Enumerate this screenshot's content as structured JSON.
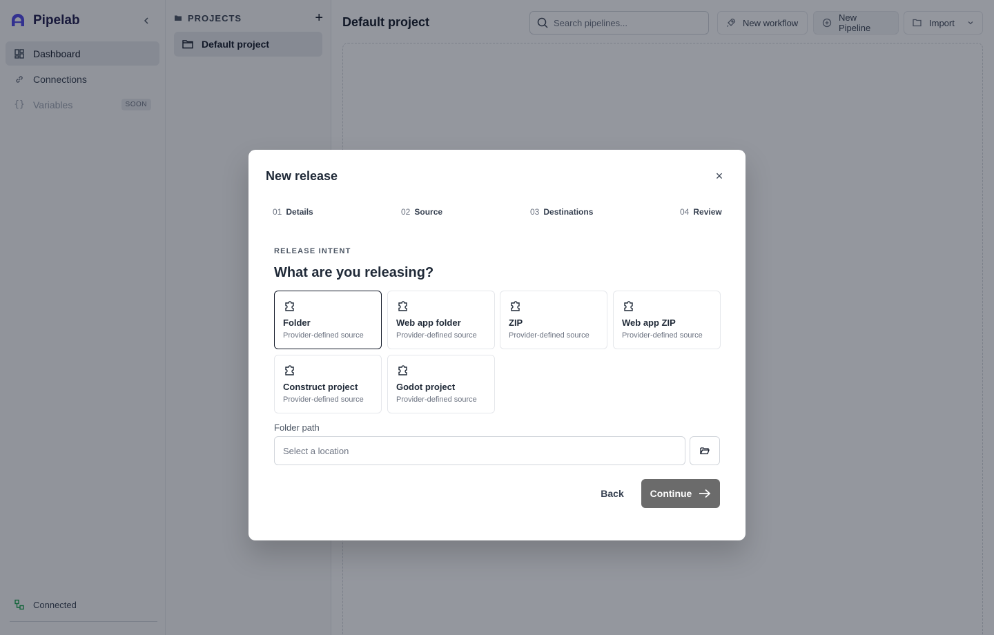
{
  "app": {
    "name": "Pipelab"
  },
  "sidebar": {
    "items": [
      {
        "label": "Dashboard",
        "icon": "dashboard-icon",
        "active": true
      },
      {
        "label": "Connections",
        "icon": "link-icon"
      },
      {
        "label": "Variables",
        "icon": "braces-icon",
        "badge": "SOON",
        "disabled": true
      }
    ],
    "status": {
      "label": "Connected",
      "icon": "network-icon",
      "color": "#16a34a"
    }
  },
  "projects": {
    "title": "PROJECTS",
    "add_label": "+",
    "items": [
      {
        "label": "Default project"
      }
    ]
  },
  "main": {
    "title": "Default project",
    "search_placeholder": "Search pipelines...",
    "new_workflow_label": "New workflow",
    "new_pipeline_label": "New Pipeline",
    "import_label": "Import"
  },
  "modal": {
    "title": "New release",
    "close_label": "×",
    "steps": [
      {
        "num": "01",
        "label": "Details"
      },
      {
        "num": "02",
        "label": "Source"
      },
      {
        "num": "03",
        "label": "Destinations"
      },
      {
        "num": "04",
        "label": "Review"
      }
    ],
    "section_label": "RELEASE INTENT",
    "question": "What are you releasing?",
    "options": [
      {
        "title": "Folder",
        "subtitle": "Provider-defined source",
        "selected": true
      },
      {
        "title": "Web app folder",
        "subtitle": "Provider-defined source"
      },
      {
        "title": "ZIP",
        "subtitle": "Provider-defined source"
      },
      {
        "title": "Web app ZIP",
        "subtitle": "Provider-defined source"
      },
      {
        "title": "Construct project",
        "subtitle": "Provider-defined source"
      },
      {
        "title": "Godot project",
        "subtitle": "Provider-defined source"
      }
    ],
    "folder_path": {
      "label": "Folder path",
      "value": "",
      "placeholder": "Select a location"
    },
    "back_label": "Back",
    "continue_label": "Continue"
  },
  "colors": {
    "brand": "#4f46e5",
    "primary_button": "#6b6b6b",
    "connected": "#16a34a"
  }
}
